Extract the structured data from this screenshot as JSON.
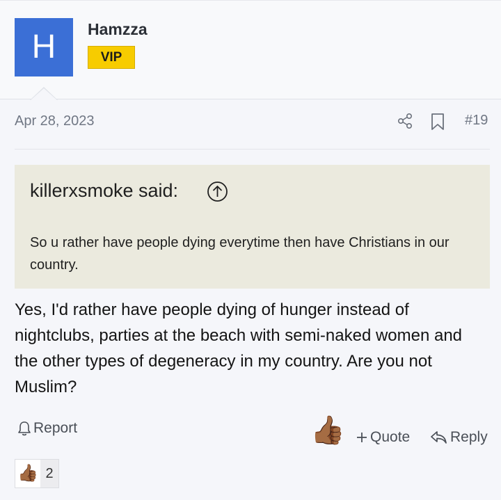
{
  "user": {
    "avatar_letter": "H",
    "name": "Hamzza",
    "badge": "VIP",
    "avatar_color": "#3b6fd6",
    "badge_color": "#f7cc00"
  },
  "post": {
    "date": "Apr 28, 2023",
    "number": "#19",
    "body": "Yes, I'd rather have people dying of hunger instead of nightclubs, parties at the beach with semi-naked women and the other types of degeneracy in my country. Are you not Muslim?"
  },
  "quote": {
    "author": "killerxsmoke said:",
    "text": "So u rather have people dying everytime then have Christians in our country."
  },
  "actions": {
    "report": "Report",
    "quote": "Quote",
    "reply": "Reply",
    "like_emoji": "👍🏾"
  },
  "reactions": {
    "emoji": "👍🏾",
    "count": "2"
  },
  "icons": [
    "share-icon",
    "bookmark-icon",
    "arrow-up-circle-icon",
    "bell-icon",
    "plus-icon",
    "reply-arrow-icon",
    "thumbs-up-icon"
  ]
}
